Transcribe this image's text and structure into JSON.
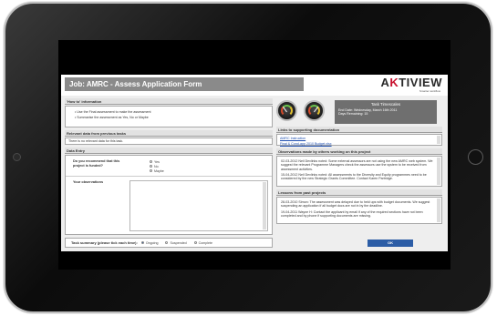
{
  "window": {
    "job_title": "Job: AMRC - Assess Application Form",
    "logo_pre": "A",
    "logo_hl": "K",
    "logo_post": "TIVIEW",
    "tagline": "Smarter workflow"
  },
  "how_to": {
    "header": "'How to' information",
    "bullets": [
      "• Use the Final assessment to make the assessment",
      "• Summarise the assessment as Yes, No or Maybe"
    ]
  },
  "relevant": {
    "header": "Relevant data from previous tasks",
    "text": "There is no relevant data for this task."
  },
  "data_entry": {
    "header": "Data Entry",
    "question": "Do you recommend that this project is funded?",
    "options": [
      "Yes",
      "No",
      "Maybe"
    ],
    "obs_label": "Your observations"
  },
  "task_panel": {
    "title": "Task Timescales",
    "end_date": "End Date: Wednesday, March 16th 2011",
    "days_remaining": "Days Remaining: 15"
  },
  "links": {
    "header": "Links to supporting documentation",
    "items": [
      "AMRC Instruction",
      "Final & Cond-app 2010 Budget.xlsx"
    ]
  },
  "observations": {
    "header": "Observations made by others working on this project",
    "entries": [
      "02-03-2012 Neil Devlinks noted: Some external assessors are not using the new AMRC web system. We suggest the relevant Programme Managers check the assessors use the system to be received from assessment activities.",
      "15-04-2012 Neil Devlinks noted: All assessments to the Diversity and Equity programmes need to be considered by the new Strategic Grants Committee. Contact Karen Partridge."
    ]
  },
  "lessons": {
    "header": "Lessons from past projects",
    "entries": [
      "28-03-2010 Simon: The assessment was delayed due to held ups with budget documents. We suggest suspending an application if all budget docs are not in by the deadline.",
      "19-04-2011 Wayne H: Contact the applicant by email if any of the required sections have not been completed and by phone if supporting documents are missing."
    ]
  },
  "summary": {
    "label": "Task summary (please tick each time):",
    "options": [
      "Ongoing",
      "Suspended",
      "Complete"
    ],
    "selected_index": 0
  },
  "ok_button": "OK",
  "gauge_levels": [
    0.3,
    0.7
  ]
}
